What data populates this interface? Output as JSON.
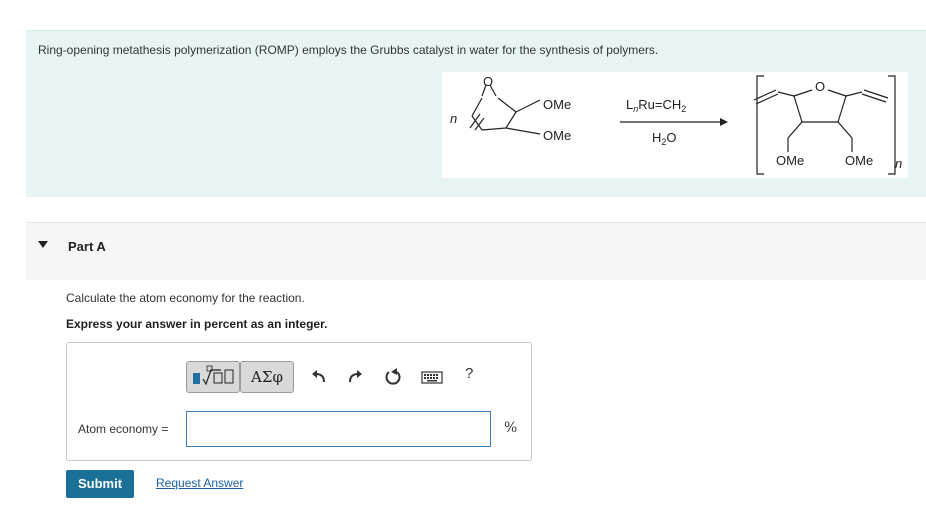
{
  "intro": {
    "text": "Ring-opening metathesis polymerization (ROMP) employs the Grubbs catalyst in water for the synthesis of polymers."
  },
  "scheme": {
    "n_label": "n",
    "o_label": "O",
    "reactant_ome_top": "OMe",
    "reactant_ome_bottom": "OMe",
    "catalyst_prefix": "L",
    "catalyst_sub": "n",
    "catalyst_rest": "Ru=CH",
    "catalyst_sub2": "2",
    "solvent_h": "H",
    "solvent_sub": "2",
    "solvent_o": "O",
    "product_o": "O",
    "product_ome_left": "OMe",
    "product_ome_right": "OMe",
    "product_n": "n"
  },
  "part_a": {
    "title": "Part A",
    "instruction": "Calculate the atom economy for the reaction.",
    "express": "Express your answer in percent as an integer."
  },
  "toolbar": {
    "greek_label": "ΑΣφ",
    "help_label": "?"
  },
  "answer": {
    "label": "Atom economy =",
    "value": "",
    "unit": "%"
  },
  "actions": {
    "submit": "Submit",
    "request": "Request Answer"
  }
}
